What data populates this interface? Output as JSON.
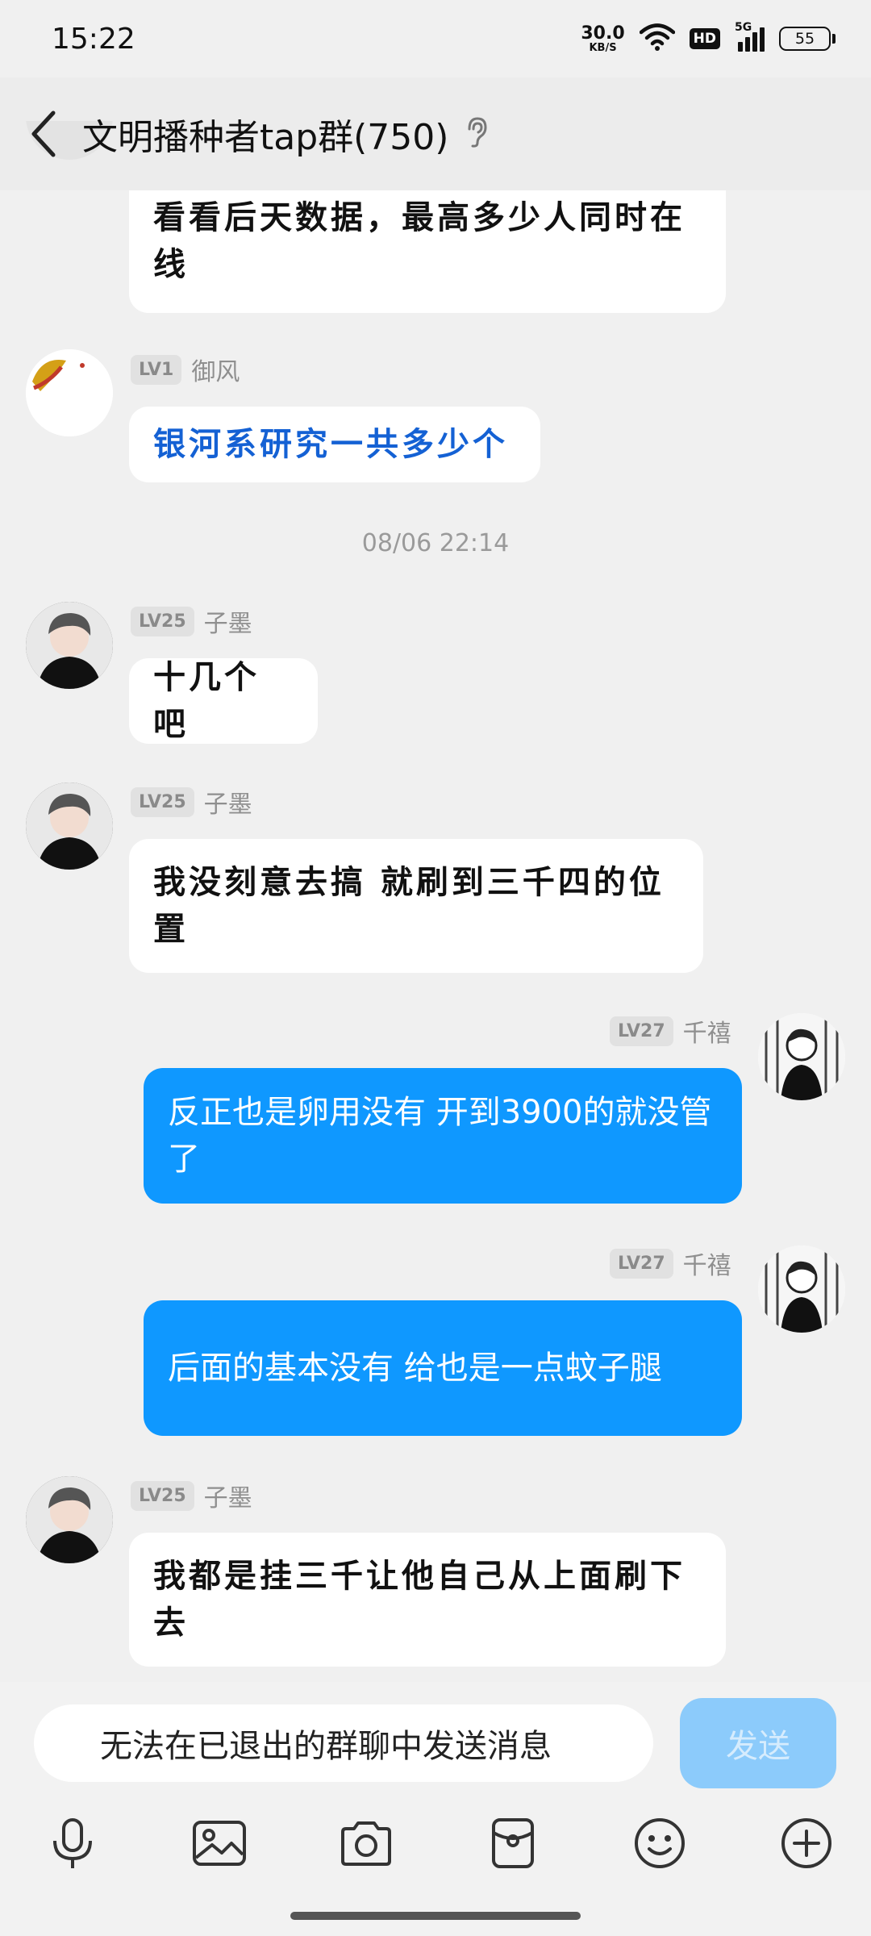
{
  "status": {
    "time": "15:22",
    "net_speed_value": "30.0",
    "net_speed_unit": "KB/S",
    "hd": "HD",
    "network": "5G",
    "battery": "55"
  },
  "header": {
    "title": "文明播种者tap群(750)"
  },
  "messages": [
    {
      "kind": "text",
      "side": "left",
      "text": "看看后天数据，最高多少人同时在线"
    },
    {
      "kind": "text",
      "side": "left",
      "level": "LV1",
      "nick": "御风",
      "text": "银河系研究一共多少个"
    },
    {
      "kind": "time",
      "text": "08/06 22:14"
    },
    {
      "kind": "text",
      "side": "left",
      "level": "LV25",
      "nick": "子墨",
      "text": "十几个吧"
    },
    {
      "kind": "text",
      "side": "left",
      "level": "LV25",
      "nick": "子墨",
      "text": "我没刻意去搞 就刷到三千四的位置"
    },
    {
      "kind": "text",
      "side": "right",
      "level": "LV27",
      "nick": "千禧",
      "text": "反正也是卵用没有 开到3900的就没管了"
    },
    {
      "kind": "text",
      "side": "right",
      "level": "LV27",
      "nick": "千禧",
      "text": "后面的基本没有 给也是一点蚊子腿"
    },
    {
      "kind": "text",
      "side": "left",
      "level": "LV25",
      "nick": "子墨",
      "text": "我都是挂三千让他自己从上面刷下去"
    }
  ],
  "input": {
    "placeholder": "无法在已退出的群聊中发送消息",
    "send_label": "发送"
  },
  "toolbar": [
    "microphone-icon",
    "image-icon",
    "camera-icon",
    "red-packet-icon",
    "emoji-icon",
    "plus-icon"
  ],
  "colors": {
    "accent": "#0f98ff",
    "send_disabled": "#8ccbfb",
    "link_text": "#1461d4",
    "background": "#f0f0f0"
  }
}
